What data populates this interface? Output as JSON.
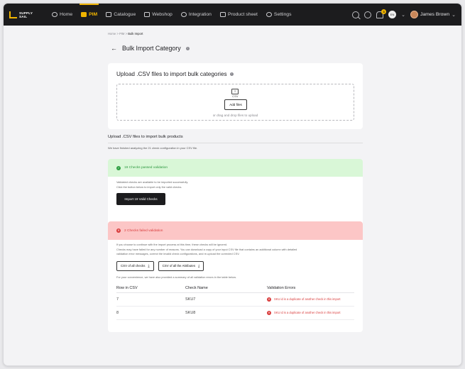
{
  "app": {
    "logo_text_top": "SUPPLY",
    "logo_text_bottom": "SAIL",
    "nav": [
      {
        "label": "Home",
        "icon": "home-icon"
      },
      {
        "label": "PIM",
        "icon": "pim-icon",
        "active": true
      },
      {
        "label": "Catalogue",
        "icon": "catalogue-icon"
      },
      {
        "label": "Webshop",
        "icon": "webshop-icon"
      },
      {
        "label": "Integration",
        "icon": "integration-icon"
      },
      {
        "label": "Product sheet",
        "icon": "product-sheet-icon"
      },
      {
        "label": "Settings",
        "icon": "settings-icon"
      }
    ],
    "notification_count": "3",
    "language_code": "EN",
    "user_name": "James Brown",
    "accent_color": "#f0b400"
  },
  "breadcrumb": {
    "home": "Home",
    "pim": "PIM",
    "current": "Bulk Import",
    "separator": ">"
  },
  "page": {
    "title": "Bulk Import Category"
  },
  "upload": {
    "title": "Upload .CSV files to import bulk categories",
    "file_type": "CSV",
    "add_files_label": "Add files",
    "drag_text": "or drag and drop files to upload"
  },
  "products": {
    "title": "Upload .CSV files to import bulk products",
    "analyzed_text": "We have finished analyzing the 21 check configuration in your CSV file."
  },
  "passed": {
    "title": "19 Checks passed validation",
    "line1": "Validated checks are available to be imported successfully.",
    "line2": "Click the button below to import only the valid checks.",
    "import_button": "Import 19 Valid Checks",
    "color": "#2e9940"
  },
  "failed": {
    "title": "2 Checks failed validation",
    "line1": "If you choose to continue with the import process at this time, these checks will be ignored.",
    "line2": "Checks may have failed for any number of reasons. You can download a copy of your input CSV file that contains an additional column with detailed",
    "line3": "validation error messages, correct the invalid check configurations, and re-upload the corrected CSV.",
    "csv_all_checks": "CSV of all checks",
    "csv_all_attributes": "CSV of all the Attributes",
    "summary_text": "For your convenience, we have also provided a summary of all validation errors in the table below.",
    "color": "#d93b3b",
    "table": {
      "headers": [
        "Row in CSV",
        "Check Name",
        "Validation Errors"
      ],
      "rows": [
        {
          "row": "7",
          "name": "SKU7",
          "error": "SKU id is a duplicate of another check in this import"
        },
        {
          "row": "8",
          "name": "SKU8",
          "error": "SKU id is a duplicate of another check in this import"
        }
      ]
    }
  }
}
